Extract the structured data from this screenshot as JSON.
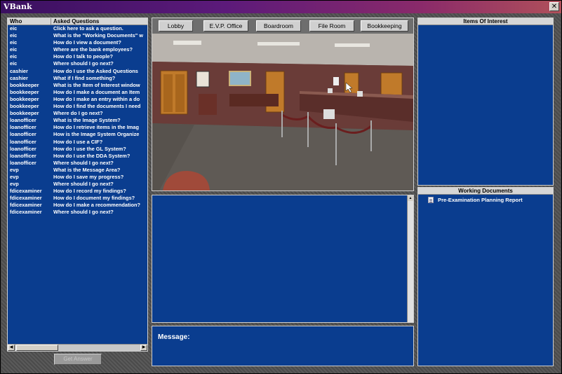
{
  "window": {
    "title": "VBank",
    "close_glyph": "✕"
  },
  "qa": {
    "col_who": "Who",
    "col_question": "Asked Questions",
    "rows": [
      {
        "who": "eic",
        "q": "Click here to ask a question."
      },
      {
        "who": "eic",
        "q": "What is the \"Working Documents\" w"
      },
      {
        "who": "eic",
        "q": "How do I view a document?"
      },
      {
        "who": "eic",
        "q": "Where are the bank employees?"
      },
      {
        "who": "eic",
        "q": "How do I talk to people?"
      },
      {
        "who": "eic",
        "q": "Where should I go next?"
      },
      {
        "who": "cashier",
        "q": "How do I use the Asked Questions"
      },
      {
        "who": "cashier",
        "q": "What if I find something?"
      },
      {
        "who": "bookkeeper",
        "q": "What is the Item of Interest window"
      },
      {
        "who": "bookkeeper",
        "q": "How do I make a document an Item"
      },
      {
        "who": "bookkeeper",
        "q": "How do I make an entry within a do"
      },
      {
        "who": "bookkeeper",
        "q": "How do I find the documents I need"
      },
      {
        "who": "bookkeeper",
        "q": "Where do I go next?"
      },
      {
        "who": "loanofficer",
        "q": "What is the Image System?"
      },
      {
        "who": "loanofficer",
        "q": "How do I retrieve items in the Imag"
      },
      {
        "who": "loanofficer",
        "q": "How is the Image System Organize"
      },
      {
        "who": "loanofficer",
        "q": "How do I use a CIF?"
      },
      {
        "who": "loanofficer",
        "q": "How do I use the GL System?"
      },
      {
        "who": "loanofficer",
        "q": "How do I use the DDA System?"
      },
      {
        "who": "loanofficer",
        "q": "Where should I go next?"
      },
      {
        "who": "evp",
        "q": "What is the Message Area?"
      },
      {
        "who": "evp",
        "q": "How do I save my progress?"
      },
      {
        "who": "evp",
        "q": "Where should I go next?"
      },
      {
        "who": "fdicexaminer",
        "q": "How do I record my findings?"
      },
      {
        "who": "fdicexaminer",
        "q": "How do I document my findings?"
      },
      {
        "who": "fdicexaminer",
        "q": "How do I make a recommendation?"
      },
      {
        "who": "fdicexaminer",
        "q": "Where should I go next?"
      }
    ],
    "scroll_left": "◀",
    "scroll_right": "▶",
    "get_answer_label": "Get Answer"
  },
  "nav": {
    "buttons": [
      "Lobby",
      "E.V.P. Office",
      "Boardroom",
      "File Room",
      "Bookkeeping"
    ]
  },
  "message": {
    "label": "Message:",
    "scroll_up": "▲"
  },
  "items_of_interest": {
    "header": "Items Of Interest"
  },
  "working_documents": {
    "header": "Working Documents",
    "items": [
      "Pre-Examination Planning Report"
    ]
  },
  "colors": {
    "panel_blue": "#0a3d8f",
    "title_gradient_start": "#3a1060"
  }
}
